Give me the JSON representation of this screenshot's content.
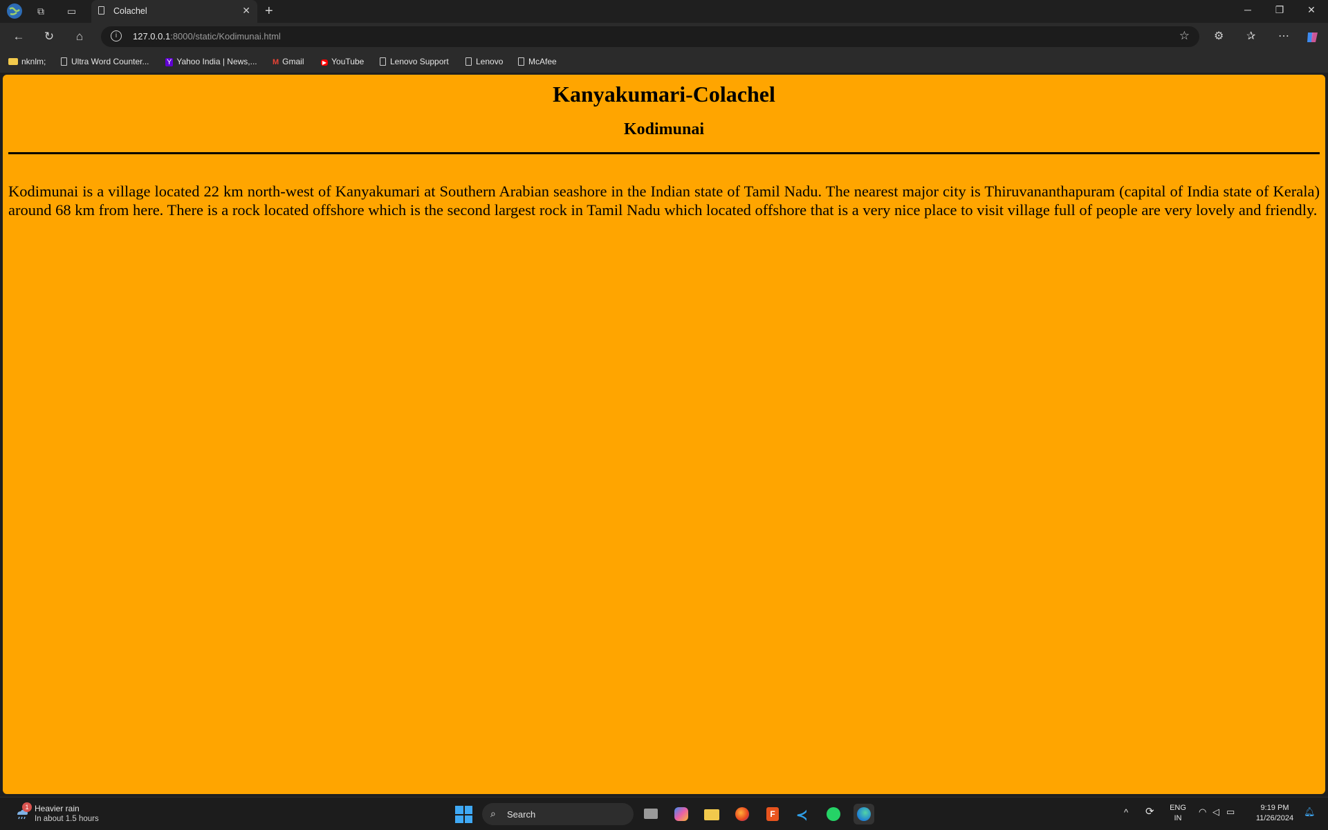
{
  "browser": {
    "tab_title": "Colachel",
    "url_host": "127.0.0.1",
    "url_rest": ":8000/static/Kodimunai.html",
    "bookmarks": [
      "nknlm;",
      "Ultra Word Counter...",
      "Yahoo India | News,...",
      "Gmail",
      "YouTube",
      "Lenovo Support",
      "Lenovo",
      "McAfee"
    ]
  },
  "page": {
    "background_color": "#FFA500",
    "title": "Kanyakumari-Colachel",
    "subtitle": "Kodimunai",
    "paragraph": "Kodimunai is a village located 22 km north-west of Kanyakumari at Southern Arabian seashore in the Indian state of Tamil Nadu. The nearest major city is Thiruvananthapuram (capital of India state of Kerala) around 68 km from here. There is a rock located offshore which is the second largest rock in Tamil Nadu which located offshore that is a very nice place to visit village full of people are very lovely and friendly."
  },
  "taskbar": {
    "weather_badge": "1",
    "weather_title": "Heavier rain",
    "weather_subtitle": "In about 1.5 hours",
    "search_label": "Search",
    "lang_top": "ENG",
    "lang_bottom": "IN",
    "time": "9:19 PM",
    "date": "11/26/2024"
  }
}
